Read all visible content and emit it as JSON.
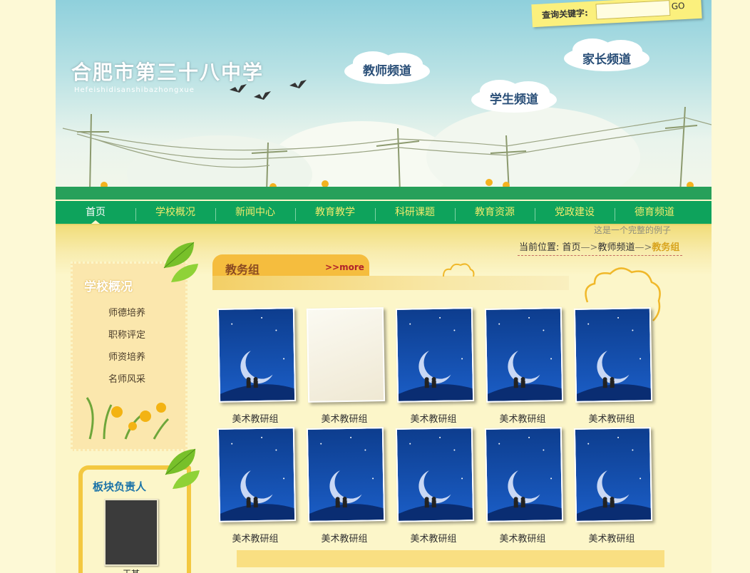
{
  "header": {
    "school_name": "合肥市第三十八中学",
    "school_pinyin": "Hefeishidisanshibazhongxue",
    "clouds": [
      "教师频道",
      "家长频道",
      "学生频道"
    ]
  },
  "search": {
    "label": "查询关键字:",
    "value": "",
    "go_label": "GO"
  },
  "nav": {
    "items": [
      "首页",
      "学校概况",
      "新闻中心",
      "教育教学",
      "科研课题",
      "教育资源",
      "党政建设",
      "德育频道"
    ],
    "active": "首页"
  },
  "example_text": "这是一个完整的例子",
  "breadcrumb": {
    "label": "当前位置:",
    "home": "首页",
    "arrow1": "—>",
    "channel": "教师频道",
    "arrow2": "—>",
    "current": "教务组"
  },
  "sidebar": {
    "title": "学校概况",
    "items": [
      "师德培养",
      "职称评定",
      "师资培养",
      "名师风采"
    ]
  },
  "owner": {
    "title": "板块负责人",
    "name": "王某"
  },
  "section": {
    "title": "教务组",
    "more_label": ">>more"
  },
  "thumbnails": [
    {
      "caption": "美术教研组",
      "image": "moon-night"
    },
    {
      "caption": "美术教研组",
      "image": "blank-paper"
    },
    {
      "caption": "美术教研组",
      "image": "moon-night"
    },
    {
      "caption": "美术教研组",
      "image": "moon-night"
    },
    {
      "caption": "美术教研组",
      "image": "moon-night"
    },
    {
      "caption": "美术教研组",
      "image": "moon-night"
    },
    {
      "caption": "美术教研组",
      "image": "moon-night"
    },
    {
      "caption": "美术教研组",
      "image": "moon-night"
    },
    {
      "caption": "美术教研组",
      "image": "moon-night"
    },
    {
      "caption": "美术教研组",
      "image": "moon-night"
    }
  ],
  "colors": {
    "nav_green": "#0ea35c",
    "nav_text": "#f3eb6c",
    "tab_orange": "#f5bd3e",
    "breadcrumb_current": "#d8a41e"
  }
}
